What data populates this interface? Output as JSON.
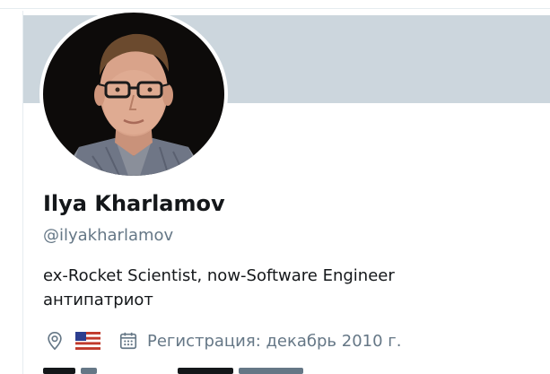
{
  "profile": {
    "name": "Ilya Kharlamov",
    "handle": "@ilyakharlamov",
    "bio_lines": [
      "ex-Rocket Scientist, now-Software Engineer",
      "антипатриот"
    ],
    "registration": "Регистрация: декабрь 2010 г.",
    "location_flag": "us-flag",
    "icons": {
      "location": "location-pin-icon",
      "calendar": "calendar-icon"
    }
  },
  "colors": {
    "banner": "#ccd6dd",
    "text_primary": "#14171a",
    "text_secondary": "#657786"
  }
}
